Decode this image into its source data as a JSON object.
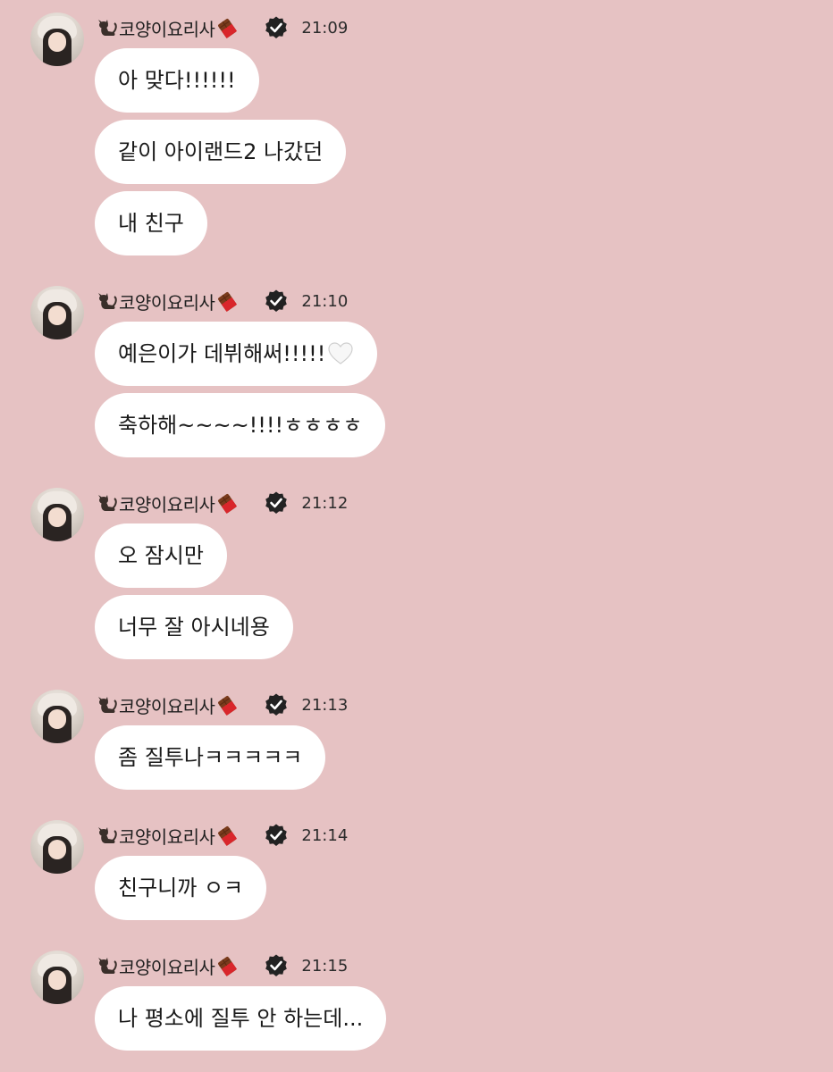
{
  "sender": {
    "name": "코양이요리사"
  },
  "icons": {
    "avatar": "profile-photo",
    "name_prefix": "black-cat-icon",
    "name_suffix": "chocolate-bar-icon",
    "badge": "verified-check-icon",
    "emoji": "white-heart-icon"
  },
  "colors": {
    "background": "#e6c2c3",
    "bubble": "#ffffff",
    "badge": "#222222"
  },
  "groups": [
    {
      "time": "21:09",
      "messages": [
        "아 맞다!!!!!!",
        "같이 아이랜드2 나갔던",
        "내 친구"
      ]
    },
    {
      "time": "21:10",
      "messages": [
        "예은이가 데뷔해써!!!!!",
        "축하해~~~~!!!!ㅎㅎㅎㅎ"
      ]
    },
    {
      "time": "21:12",
      "messages": [
        "오 잠시만",
        "너무 잘 아시네용"
      ]
    },
    {
      "time": "21:13",
      "messages": [
        "좀 질투나ㅋㅋㅋㅋㅋ"
      ]
    },
    {
      "time": "21:14",
      "messages": [
        "친구니까 ㅇㅋ"
      ]
    },
    {
      "time": "21:15",
      "messages": [
        "나 평소에 질투 안 하는데..."
      ]
    }
  ]
}
